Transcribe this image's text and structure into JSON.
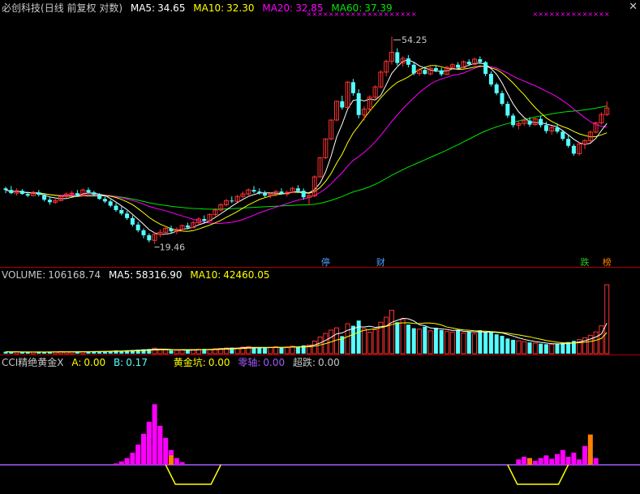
{
  "colors": {
    "up": "#ff3232",
    "down": "#54ffff",
    "ma5": "#ffffff",
    "ma10": "#ffff00",
    "ma20": "#ff00ff",
    "ma60": "#00e600",
    "label": "#c8c8c8",
    "sep": "#b00000",
    "gold": "#ffff00",
    "zero": "#a25aff",
    "chaodie": "#c8c8c8",
    "cci_bar": "#ff00ff",
    "cci_bar_alt": "#ff8000",
    "pit": "#ffff00"
  },
  "price_panel": {
    "stock": "必创科技",
    "mode": "(日线 前复权 对数)",
    "ma5": {
      "label": "MA5:",
      "value": "34.65"
    },
    "ma10": {
      "label": "MA10:",
      "value": "32.30"
    },
    "ma20": {
      "label": "MA20:",
      "value": "32.85"
    },
    "ma60": {
      "label": "MA60:",
      "value": "37.39"
    },
    "high_label": "54.25",
    "low_label": "19.46",
    "markers": [
      "停",
      "财",
      "跌",
      "榜"
    ],
    "close_icon": "✕"
  },
  "volume_panel": {
    "volume": {
      "label": "VOLUME:",
      "value": "106168.74"
    },
    "ma5": {
      "label": "MA5:",
      "value": "58316.90"
    },
    "ma10": {
      "label": "MA10:",
      "value": "42460.05"
    }
  },
  "cci_panel": {
    "name": "CCI精绝黄金X",
    "a": {
      "label": "A:",
      "value": "0.00"
    },
    "b": {
      "label": "B:",
      "value": "0.17"
    },
    "gold": {
      "label": "黄金坑:",
      "value": "0.00"
    },
    "zero": {
      "label": "零轴:",
      "value": "0.00"
    },
    "chaodie": {
      "label": "超跌:",
      "value": "0.00"
    }
  },
  "chart_data": [
    {
      "type": "candlestick",
      "scale": "log",
      "ylim": [
        18,
        60
      ],
      "candles": [
        [
          25.6,
          25.8,
          25.0,
          25.4
        ],
        [
          25.4,
          25.9,
          24.9,
          25.0
        ],
        [
          25.0,
          25.6,
          24.7,
          25.3
        ],
        [
          25.3,
          25.5,
          24.8,
          24.9
        ],
        [
          24.9,
          25.2,
          24.5,
          24.7
        ],
        [
          24.7,
          25.3,
          24.6,
          25.1
        ],
        [
          25.1,
          25.4,
          24.6,
          24.8
        ],
        [
          24.8,
          25.0,
          24.0,
          24.2
        ],
        [
          24.2,
          24.5,
          23.6,
          23.9
        ],
        [
          23.9,
          24.3,
          23.7,
          24.1
        ],
        [
          24.1,
          24.8,
          24.0,
          24.6
        ],
        [
          24.6,
          25.1,
          24.4,
          24.9
        ],
        [
          24.9,
          25.3,
          24.7,
          25.0
        ],
        [
          25.0,
          25.4,
          24.6,
          24.7
        ],
        [
          24.7,
          25.6,
          24.6,
          25.4
        ],
        [
          25.4,
          25.7,
          25.0,
          25.1
        ],
        [
          25.1,
          25.3,
          24.6,
          24.8
        ],
        [
          24.8,
          25.0,
          24.2,
          24.3
        ],
        [
          24.3,
          24.6,
          23.8,
          24.0
        ],
        [
          24.0,
          24.2,
          23.3,
          23.5
        ],
        [
          23.5,
          23.8,
          22.8,
          23.0
        ],
        [
          23.0,
          23.4,
          22.4,
          22.6
        ],
        [
          22.6,
          22.9,
          21.9,
          22.1
        ],
        [
          22.1,
          22.4,
          21.2,
          21.4
        ],
        [
          21.4,
          21.7,
          20.6,
          20.8
        ],
        [
          20.8,
          21.0,
          20.0,
          20.3
        ],
        [
          20.3,
          20.5,
          19.6,
          19.8
        ],
        [
          19.8,
          20.6,
          19.46,
          20.4
        ],
        [
          20.4,
          20.9,
          20.1,
          20.6
        ],
        [
          20.6,
          21.2,
          20.4,
          21.0
        ],
        [
          21.0,
          21.3,
          20.5,
          20.7
        ],
        [
          20.7,
          21.1,
          20.4,
          20.9
        ],
        [
          20.9,
          21.4,
          20.7,
          21.3
        ],
        [
          21.3,
          21.6,
          20.9,
          21.1
        ],
        [
          21.1,
          21.8,
          21.0,
          21.6
        ],
        [
          21.6,
          22.2,
          21.4,
          22.0
        ],
        [
          22.0,
          22.4,
          21.6,
          21.8
        ],
        [
          21.8,
          22.6,
          21.7,
          22.5
        ],
        [
          22.5,
          23.2,
          22.3,
          23.0
        ],
        [
          23.0,
          23.8,
          22.8,
          23.6
        ],
        [
          23.6,
          24.3,
          23.4,
          24.1
        ],
        [
          24.1,
          24.6,
          23.8,
          24.0
        ],
        [
          24.0,
          24.8,
          23.9,
          24.6
        ],
        [
          24.6,
          25.2,
          24.4,
          24.9
        ],
        [
          24.9,
          25.6,
          24.7,
          25.4
        ],
        [
          25.4,
          25.9,
          25.0,
          25.2
        ],
        [
          25.2,
          25.6,
          24.8,
          25.0
        ],
        [
          25.0,
          25.3,
          24.5,
          24.7
        ],
        [
          24.7,
          25.1,
          24.4,
          24.9
        ],
        [
          24.9,
          25.4,
          24.6,
          25.2
        ],
        [
          25.2,
          25.6,
          24.8,
          24.9
        ],
        [
          24.9,
          25.3,
          24.6,
          25.1
        ],
        [
          25.1,
          25.8,
          25.0,
          25.6
        ],
        [
          25.6,
          26.0,
          25.0,
          25.3
        ],
        [
          25.3,
          25.6,
          24.2,
          24.5
        ],
        [
          24.5,
          24.9,
          23.6,
          24.7
        ],
        [
          24.7,
          27.3,
          24.5,
          27.1
        ],
        [
          27.1,
          29.9,
          27.0,
          29.8
        ],
        [
          29.8,
          32.8,
          29.6,
          32.7
        ],
        [
          32.7,
          36.0,
          32.5,
          35.9
        ],
        [
          35.9,
          39.5,
          35.7,
          39.4
        ],
        [
          39.4,
          40.5,
          37.8,
          38.2
        ],
        [
          38.2,
          43.5,
          38.0,
          43.3
        ],
        [
          43.3,
          44.0,
          40.5,
          41.0
        ],
        [
          41.0,
          41.8,
          36.2,
          36.8
        ],
        [
          36.8,
          38.4,
          35.8,
          37.9
        ],
        [
          37.9,
          40.6,
          37.5,
          40.2
        ],
        [
          40.2,
          42.6,
          39.6,
          42.3
        ],
        [
          42.3,
          45.9,
          42.0,
          45.5
        ],
        [
          45.5,
          48.4,
          44.6,
          48.0
        ],
        [
          48.0,
          54.25,
          47.2,
          50.2
        ],
        [
          50.2,
          51.2,
          47.0,
          47.6
        ],
        [
          47.6,
          49.2,
          46.8,
          48.7
        ],
        [
          48.7,
          49.5,
          46.6,
          47.2
        ],
        [
          47.2,
          47.9,
          44.8,
          45.2
        ],
        [
          45.2,
          46.4,
          44.6,
          46.0
        ],
        [
          46.0,
          46.8,
          44.9,
          45.1
        ],
        [
          45.1,
          46.7,
          44.8,
          46.4
        ],
        [
          46.4,
          47.0,
          45.5,
          45.9
        ],
        [
          45.9,
          46.5,
          44.6,
          45.0
        ],
        [
          45.0,
          46.9,
          44.8,
          46.6
        ],
        [
          46.6,
          47.6,
          46.1,
          47.2
        ],
        [
          47.2,
          47.8,
          46.2,
          46.5
        ],
        [
          46.5,
          48.2,
          46.3,
          47.9
        ],
        [
          47.9,
          48.5,
          46.9,
          47.3
        ],
        [
          47.3,
          48.9,
          47.1,
          48.5
        ],
        [
          48.5,
          49.2,
          47.4,
          47.8
        ],
        [
          47.8,
          48.1,
          44.6,
          45.1
        ],
        [
          45.1,
          45.7,
          42.4,
          42.8
        ],
        [
          42.8,
          43.2,
          40.6,
          41.0
        ],
        [
          41.0,
          41.5,
          38.5,
          38.9
        ],
        [
          38.9,
          39.4,
          36.3,
          36.7
        ],
        [
          36.7,
          37.1,
          34.6,
          35.0
        ],
        [
          35.0,
          35.6,
          34.3,
          35.3
        ],
        [
          35.3,
          36.2,
          34.9,
          35.8
        ],
        [
          35.8,
          36.4,
          34.7,
          35.1
        ],
        [
          35.1,
          36.3,
          34.9,
          36.1
        ],
        [
          36.1,
          36.6,
          34.6,
          35.0
        ],
        [
          35.0,
          35.6,
          33.6,
          34.0
        ],
        [
          34.0,
          34.9,
          33.4,
          34.6
        ],
        [
          34.6,
          35.3,
          33.6,
          33.9
        ],
        [
          33.9,
          34.2,
          32.4,
          32.7
        ],
        [
          32.7,
          33.4,
          31.3,
          31.6
        ],
        [
          31.6,
          31.9,
          30.1,
          30.4
        ],
        [
          30.4,
          32.2,
          30.1,
          31.9
        ],
        [
          31.9,
          32.7,
          31.1,
          32.4
        ],
        [
          32.4,
          34.1,
          32.1,
          33.8
        ],
        [
          33.8,
          35.6,
          33.6,
          35.4
        ],
        [
          35.4,
          37.3,
          35.1,
          36.9
        ],
        [
          36.9,
          39.4,
          36.6,
          38.1
        ]
      ],
      "ma_values": {
        "MA5": 34.65,
        "MA10": 32.3,
        "MA20": 32.85,
        "MA60": 37.39
      },
      "annotations": [
        "54.25",
        "19.46"
      ]
    },
    {
      "type": "bar",
      "name": "volume",
      "values": [
        3000,
        2500,
        2800,
        2200,
        2600,
        2400,
        3100,
        2300,
        2700,
        2900,
        3300,
        2600,
        2800,
        3500,
        3000,
        3200,
        3800,
        3400,
        3900,
        4200,
        4800,
        4400,
        5200,
        5600,
        6100,
        6800,
        7200,
        8500,
        6500,
        5800,
        5200,
        4900,
        5600,
        6200,
        5900,
        6800,
        7400,
        6600,
        7800,
        8200,
        8800,
        9400,
        8600,
        10200,
        11000,
        9800,
        9200,
        8700,
        9500,
        10800,
        9900,
        10400,
        11600,
        10100,
        12800,
        13400,
        19500,
        25800,
        31200,
        36400,
        39800,
        27000,
        46200,
        43000,
        51000,
        38600,
        33100,
        36900,
        48500,
        56200,
        66800,
        48400,
        52600,
        44700,
        39200,
        37800,
        41500,
        35200,
        39900,
        36400,
        34100,
        33300,
        36800,
        31900,
        34200,
        30500,
        36100,
        32900,
        33700,
        29800,
        27500,
        23400,
        21300,
        19800,
        18600,
        17300,
        16200,
        15400,
        14600,
        14200,
        15100,
        16300,
        17900,
        19700,
        21800,
        24500,
        28300,
        33600,
        42900,
        106168.74
      ],
      "ma5": 58316.9,
      "ma10": 42460.05,
      "ylim": [
        0,
        110000
      ]
    },
    {
      "type": "bar",
      "name": "CCI精绝黄金X",
      "series": [
        {
          "name": "A",
          "last": 0.0
        },
        {
          "name": "B",
          "last": 0.17
        },
        {
          "name": "黄金坑",
          "last": 0.0
        },
        {
          "name": "零轴",
          "last": 0.0
        },
        {
          "name": "超跌",
          "last": 0.0
        }
      ],
      "values": [
        0,
        0,
        0,
        0,
        0,
        0,
        0,
        0,
        0,
        0,
        0,
        0,
        0,
        0,
        0,
        0,
        0,
        0,
        0,
        0,
        2,
        5,
        10,
        18,
        30,
        46,
        64,
        90,
        58,
        40,
        22,
        10,
        4,
        0,
        0,
        0,
        0,
        0,
        0,
        0,
        0,
        0,
        0,
        0,
        0,
        0,
        0,
        0,
        0,
        0,
        0,
        0,
        0,
        0,
        0,
        0,
        0,
        0,
        0,
        0,
        0,
        0,
        0,
        0,
        0,
        0,
        0,
        0,
        0,
        0,
        0,
        0,
        0,
        0,
        0,
        0,
        0,
        0,
        0,
        0,
        0,
        0,
        0,
        0,
        0,
        0,
        0,
        0,
        0,
        0,
        0,
        0,
        0,
        0,
        0,
        0,
        0,
        0,
        0,
        0,
        0,
        0,
        0,
        0,
        0,
        0,
        0,
        0,
        0,
        0
      ],
      "orange_values": [
        0,
        0,
        0,
        0,
        0,
        0,
        0,
        0,
        0,
        0,
        0,
        0,
        0,
        0,
        0,
        0,
        0,
        0,
        0,
        0,
        0,
        0,
        0,
        0,
        0,
        0,
        0,
        0,
        0,
        0,
        14,
        0,
        0,
        0,
        0,
        0,
        0,
        0,
        0,
        0,
        0,
        0,
        0,
        0,
        0,
        0,
        0,
        0,
        0,
        0,
        0,
        0,
        0,
        0,
        0,
        0,
        0,
        0,
        0,
        0,
        0,
        0,
        0,
        0,
        0,
        0,
        0,
        0,
        0,
        0,
        0,
        0,
        0,
        0,
        0,
        0,
        0,
        0,
        0,
        0,
        0,
        0,
        0,
        0,
        0,
        0,
        0,
        0,
        0,
        0,
        0,
        0,
        0,
        0,
        0,
        0,
        0,
        0,
        0,
        0,
        0,
        0,
        0,
        0,
        0,
        0,
        0,
        0,
        0,
        0
      ],
      "pits": [
        [
          29,
          39
        ],
        [
          91,
          102
        ]
      ],
      "ylim": [
        -30,
        100
      ]
    }
  ]
}
